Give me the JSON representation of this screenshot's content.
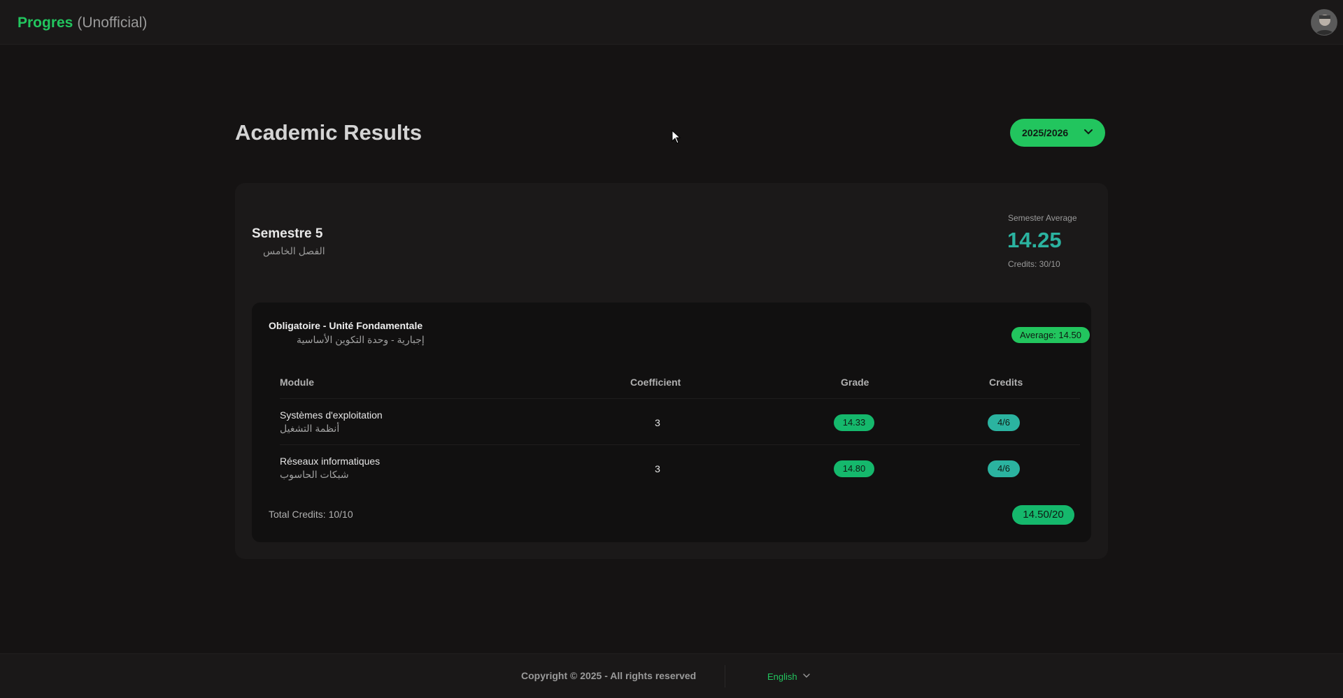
{
  "header": {
    "brand_name": "Progres",
    "brand_tag": "(Unofficial)",
    "avatar_icon": "user-avatar"
  },
  "page": {
    "title": "Academic Results",
    "year_selector": {
      "value": "2025/2026",
      "icon": "chevron-down-icon"
    }
  },
  "semester": {
    "title": "Semestre 5",
    "subtitle_ar": "الفصل الخامس",
    "average_label": "Semester Average",
    "average_value": "14.25",
    "credits": "Credits: 30/10"
  },
  "unit": {
    "title": "Obligatoire - Unité Fondamentale",
    "subtitle_ar": "إجبارية - وحدة التكوين الأساسية",
    "average_badge": "Average: 14.50",
    "columns": [
      "Module",
      "Coefficient",
      "Grade",
      "Credits"
    ],
    "rows": [
      {
        "name": "Systèmes d'exploitation",
        "name_ar": "أنظمة التشغيل",
        "coefficient": "3",
        "grade": "14.33",
        "credits": "4/6"
      },
      {
        "name": "Réseaux informatiques",
        "name_ar": "شبكات الحاسوب",
        "coefficient": "3",
        "grade": "14.80",
        "credits": "4/6"
      }
    ],
    "total_credits": "Total Credits: 10/10",
    "total_grade": "14.50/20"
  },
  "footer": {
    "copyright": "Copyright © 2025 - All rights reserved",
    "language": "English"
  },
  "colors": {
    "accent": "#22c55e",
    "teal": "#2bb3a0",
    "background": "#151313"
  }
}
